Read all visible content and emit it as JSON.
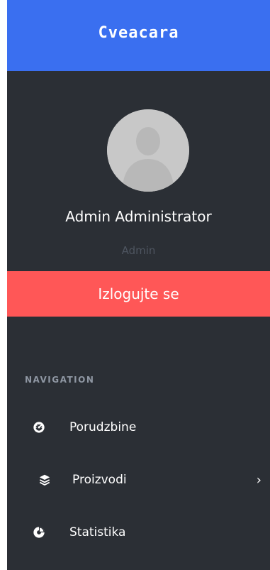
{
  "app": {
    "title": "Cveacara"
  },
  "profile": {
    "name": "Admin Administrator",
    "role": "Admin"
  },
  "actions": {
    "logout_label": "Izlogujte se"
  },
  "navigation": {
    "heading": "NAVIGATION",
    "items": [
      {
        "label": "Porudzbine",
        "icon": "dashboard-icon",
        "has_submenu": false
      },
      {
        "label": "Proizvodi",
        "icon": "layers-icon",
        "has_submenu": true
      },
      {
        "label": "Statistika",
        "icon": "pie-chart-icon",
        "has_submenu": false
      }
    ],
    "submenu_indicator": "›"
  },
  "colors": {
    "brand": "#3a6ff0",
    "sidebar_bg": "#2b2f35",
    "logout": "#ff5757",
    "text": "#ffffff",
    "muted": "#8f97a3",
    "role": "#4e5560"
  }
}
